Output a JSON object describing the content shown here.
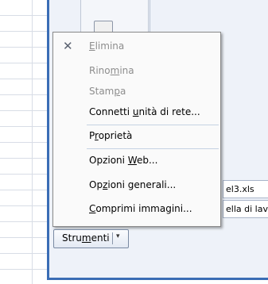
{
  "menu": {
    "items": [
      {
        "pre": "",
        "u": "E",
        "post": "limina",
        "disabled": true,
        "icon": "delete-x-icon"
      },
      {
        "pre": "Rino",
        "u": "m",
        "post": "ina",
        "disabled": true
      },
      {
        "pre": "Stam",
        "u": "p",
        "post": "a",
        "disabled": true
      },
      {
        "pre": "Connetti ",
        "u": "u",
        "post": "nità di rete...",
        "disabled": false
      },
      {
        "pre": "P",
        "u": "r",
        "post": "oprietà",
        "disabled": false
      },
      {
        "pre": "Opzioni ",
        "u": "W",
        "post": "eb...",
        "disabled": false
      },
      {
        "pre": "Op",
        "u": "z",
        "post": "ioni generali...",
        "disabled": false
      },
      {
        "pre": "",
        "u": "C",
        "post": "omprimi immagini...",
        "disabled": false
      }
    ]
  },
  "tools_button": {
    "pre": "Stru",
    "u": "m",
    "post": "enti"
  },
  "files": [
    "el3.xls",
    "ella di lav"
  ],
  "icons": {
    "delete": "✕",
    "dropdown": "▾"
  },
  "colors": {
    "frame": "#3a6db5",
    "disabled_text": "#8d8d8d"
  }
}
